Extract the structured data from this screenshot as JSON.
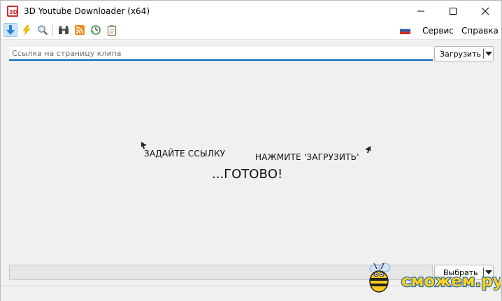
{
  "window": {
    "title": "3D Youtube Downloader (x64)"
  },
  "toolbar": {
    "icons": [
      "download-icon",
      "lightning-icon",
      "magnifier-icon",
      "binoculars-icon",
      "rss-icon",
      "clock-arrow-icon",
      "clipboard-icon"
    ]
  },
  "menu": {
    "language_flag": "russia-flag-icon",
    "service_label": "Сервис",
    "help_label": "Справка"
  },
  "url_field": {
    "placeholder": "Ссылка на страницу клипа",
    "value": ""
  },
  "load_button": {
    "label": "Загрузить"
  },
  "hints": {
    "set_link": "ЗАДАЙТЕ ССЫЛКУ",
    "press_load": "НАЖМИТЕ 'ЗАГРУЗИТЬ'",
    "ready": "...ГОТОВО!"
  },
  "choose_button": {
    "label": "Выбрать"
  },
  "watermark": {
    "text": "сможем.ру"
  },
  "colors": {
    "accent": "#0067c0",
    "background": "#f0f0f0",
    "watermark_fill": "#ffd21f",
    "watermark_outline": "#1a5fa8"
  }
}
